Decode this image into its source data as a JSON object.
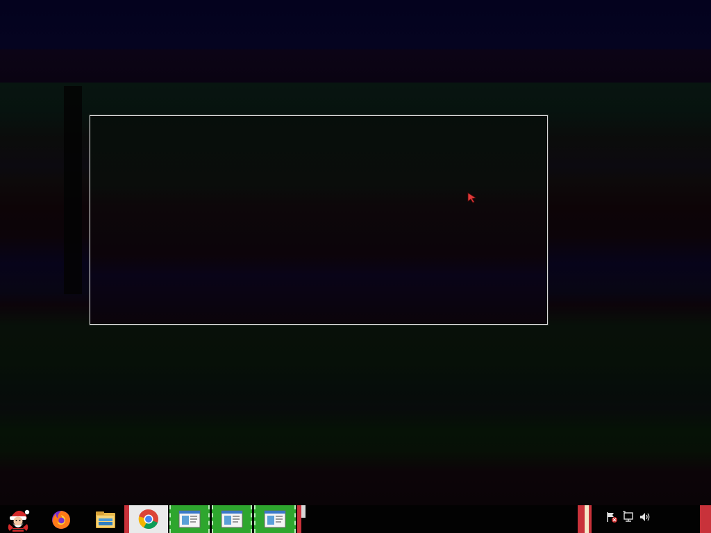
{
  "colors": {
    "taskbar_bg": "#020202",
    "taskbar_button_active": "#2ea62e",
    "selection_border": "#d8d8d8",
    "cursor": "#e03a3a",
    "accent_red": "#c8323a"
  },
  "taskbar": {
    "start": {
      "icon": "santa-start-icon"
    },
    "pinned": [
      {
        "icon": "firefox-icon"
      },
      {
        "icon": "file-explorer-icon"
      },
      {
        "icon": "chrome-icon"
      },
      {
        "icon": "window-app-icon"
      },
      {
        "icon": "window-app-icon"
      },
      {
        "icon": "window-app-icon"
      }
    ],
    "tray": [
      {
        "icon": "action-center-flag-icon"
      },
      {
        "icon": "network-icon"
      },
      {
        "icon": "speaker-icon"
      }
    ]
  },
  "desktop": {
    "selection_rectangle": true,
    "cursor": "red-arrow-cursor"
  }
}
